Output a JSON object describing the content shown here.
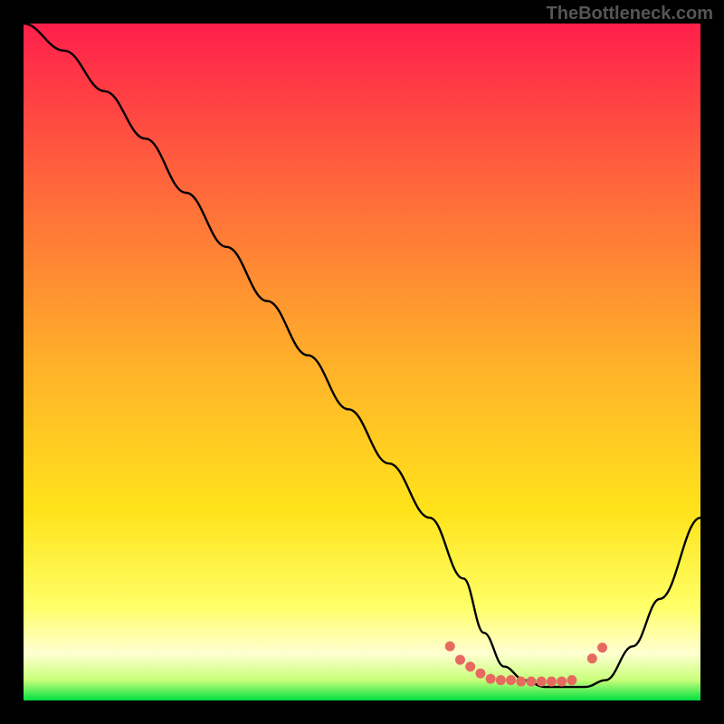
{
  "watermark": "TheBottleneck.com",
  "chart_data": {
    "type": "line",
    "title": "",
    "xlabel": "",
    "ylabel": "",
    "xlim": [
      0,
      100
    ],
    "ylim": [
      0,
      100
    ],
    "x": [
      0,
      6,
      12,
      18,
      24,
      30,
      36,
      42,
      48,
      54,
      60,
      65,
      68,
      71,
      74,
      77,
      80,
      83,
      86,
      90,
      94,
      100
    ],
    "values": [
      100,
      96,
      90,
      83,
      75,
      67,
      59,
      51,
      43,
      35,
      27,
      18,
      10,
      5,
      3,
      2,
      2,
      2,
      3,
      8,
      15,
      27
    ],
    "flat_zone": {
      "x_start": 68,
      "x_end": 86,
      "y": 3
    },
    "markers": {
      "x": [
        63,
        64.5,
        66,
        67.5,
        69,
        70.5,
        72,
        73.5,
        75,
        76.5,
        78,
        79.5,
        81,
        84,
        85.5
      ],
      "y": [
        8,
        6,
        5,
        4,
        3.2,
        3,
        3,
        2.8,
        2.8,
        2.8,
        2.8,
        2.8,
        3,
        6.2,
        7.8
      ]
    },
    "gradient_stops": [
      {
        "offset": 0.0,
        "color": "#ff1f4b"
      },
      {
        "offset": 0.25,
        "color": "#ff6a3a"
      },
      {
        "offset": 0.5,
        "color": "#ffb02a"
      },
      {
        "offset": 0.72,
        "color": "#ffe31a"
      },
      {
        "offset": 0.86,
        "color": "#ffff66"
      },
      {
        "offset": 0.93,
        "color": "#ffffd0"
      },
      {
        "offset": 0.97,
        "color": "#c8ff7a"
      },
      {
        "offset": 1.0,
        "color": "#00e040"
      }
    ],
    "marker_color": "#e76a60",
    "curve_color": "#000000"
  }
}
